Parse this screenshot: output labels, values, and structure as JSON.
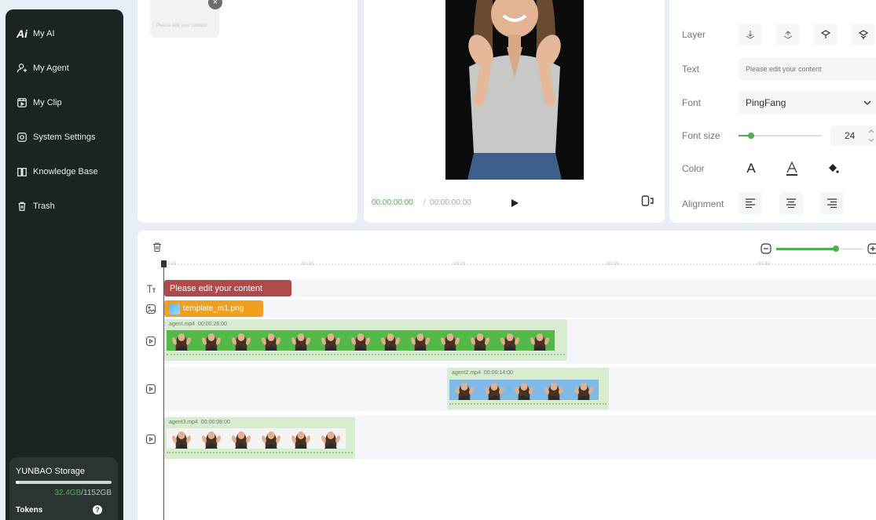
{
  "sidebar": {
    "items": [
      {
        "label": "My AI",
        "icon": "ai-logo"
      },
      {
        "label": "My Agent",
        "icon": "agent-icon"
      },
      {
        "label": "My Clip",
        "icon": "clip-icon"
      },
      {
        "label": "System Settings",
        "icon": "settings-icon"
      },
      {
        "label": "Knowledge Base",
        "icon": "book-icon"
      },
      {
        "label": "Trash",
        "icon": "trash-icon"
      }
    ],
    "logo_text": "Ai",
    "storage": {
      "title": "YUNBAO Storage",
      "used": "32.4GB",
      "sep": "/",
      "total": "1152GB",
      "fraction": 0.03,
      "tokens_label": "Tokens",
      "help": "?"
    }
  },
  "assets": {
    "thumb_caption": "Please edit your content",
    "close": "×"
  },
  "preview": {
    "time_current": "00:00:00:00",
    "time_sep": "/",
    "time_total": "00:00:00:00"
  },
  "properties": {
    "layer_label": "Layer",
    "text_label": "Text",
    "text_placeholder": "Please edit your content",
    "font_label": "Font",
    "font_value": "PingFang",
    "font_size_label": "Font size",
    "font_size_value": "24",
    "font_size_fraction": 0.15,
    "color_label": "Color",
    "color_glyph": "A",
    "alignment_label": "Alignment"
  },
  "timeline": {
    "ruler_ticks": [
      "00:00",
      "00:10",
      "00:20",
      "00:30",
      "00:40"
    ],
    "text_clip": "Please edit your content",
    "image_clip": "template_m1.png",
    "video_clips": [
      {
        "name": "agent.mp4",
        "duration": "00:00:26:00"
      },
      {
        "name": "agent2.mp4",
        "duration": "00:00:14:00"
      },
      {
        "name": "agent3.mp4",
        "duration": "00:00:08:00"
      }
    ],
    "zoom_fraction": 0.73
  },
  "colors": {
    "accent": "#4caf50",
    "sidebar": "#1c2423",
    "text_clip": "#b04a4a",
    "image_clip": "#f0a020",
    "video_clip": "#d8eccf"
  }
}
